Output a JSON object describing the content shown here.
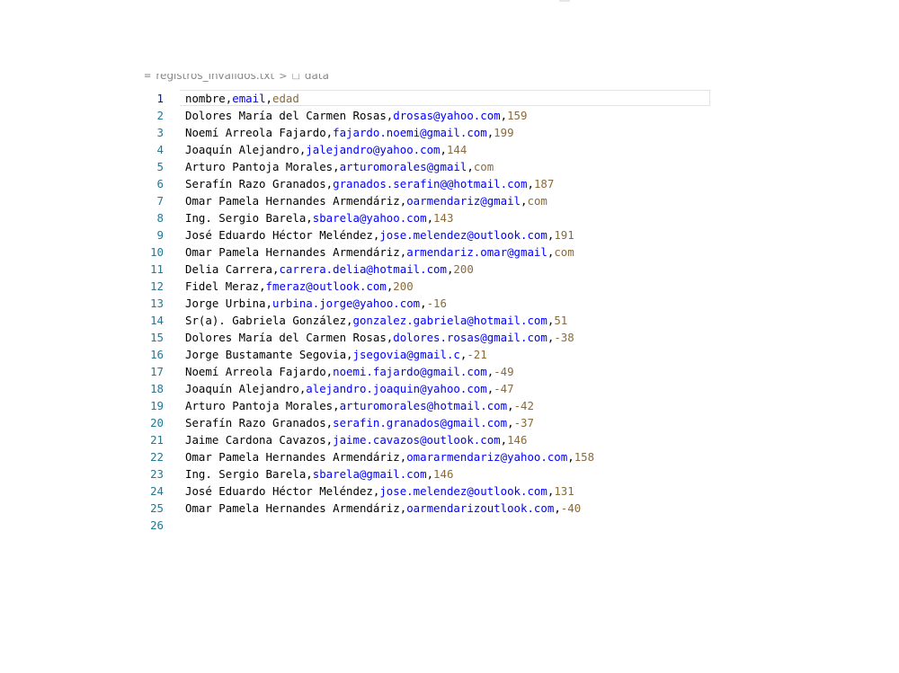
{
  "breadcrumb": {
    "file": "registros_invalidos.txt",
    "separator": ">",
    "section": "data"
  },
  "colors": {
    "text": "#000000",
    "email": "#0000ff",
    "age": "#8a6a3a",
    "line_number": "#237893",
    "active_line_number": "#0b216f"
  },
  "editor": {
    "lines": [
      {
        "number": "1",
        "name": "nombre",
        "email": "email",
        "age": "edad"
      },
      {
        "number": "2",
        "name": "Dolores María del Carmen Rosas",
        "email": "drosas@yahoo.com",
        "age": "159"
      },
      {
        "number": "3",
        "name": "Noemí Arreola Fajardo",
        "email": "fajardo.noemi@gmail.com",
        "age": "199"
      },
      {
        "number": "4",
        "name": "Joaquín Alejandro",
        "email": "jalejandro@yahoo.com",
        "age": "144"
      },
      {
        "number": "5",
        "name": "Arturo Pantoja Morales",
        "email": "arturomorales@gmail",
        "age": "com"
      },
      {
        "number": "6",
        "name": "Serafín Razo Granados",
        "email": "granados.serafin@@hotmail.com",
        "age": "187"
      },
      {
        "number": "7",
        "name": "Omar Pamela Hernandes Armendáriz",
        "email": "oarmendariz@gmail",
        "age": "com"
      },
      {
        "number": "8",
        "name": "Ing. Sergio Barela",
        "email": "sbarela@yahoo.com",
        "age": "143"
      },
      {
        "number": "9",
        "name": "José Eduardo Héctor Meléndez",
        "email": "jose.melendez@outlook.com",
        "age": "191"
      },
      {
        "number": "10",
        "name": "Omar Pamela Hernandes Armendáriz",
        "email": "armendariz.omar@gmail",
        "age": "com"
      },
      {
        "number": "11",
        "name": "Delia Carrera",
        "email": "carrera.delia@hotmail.com",
        "age": "200"
      },
      {
        "number": "12",
        "name": "Fidel Meraz",
        "email": "fmeraz@outlook.com",
        "age": "200"
      },
      {
        "number": "13",
        "name": "Jorge Urbina",
        "email": "urbina.jorge@yahoo.com",
        "age": "-16"
      },
      {
        "number": "14",
        "name": "Sr(a). Gabriela González",
        "email": "gonzalez.gabriela@hotmail.com",
        "age": "51"
      },
      {
        "number": "15",
        "name": "Dolores María del Carmen Rosas",
        "email": "dolores.rosas@gmail.com",
        "age": "-38"
      },
      {
        "number": "16",
        "name": "Jorge Bustamante Segovia",
        "email": "jsegovia@gmail.c",
        "age": "-21"
      },
      {
        "number": "17",
        "name": "Noemí Arreola Fajardo",
        "email": "noemi.fajardo@gmail.com",
        "age": "-49"
      },
      {
        "number": "18",
        "name": "Joaquín Alejandro",
        "email": "alejandro.joaquin@yahoo.com",
        "age": "-47"
      },
      {
        "number": "19",
        "name": "Arturo Pantoja Morales",
        "email": "arturomorales@hotmail.com",
        "age": "-42"
      },
      {
        "number": "20",
        "name": "Serafín Razo Granados",
        "email": "serafin.granados@gmail.com",
        "age": "-37"
      },
      {
        "number": "21",
        "name": "Jaime Cardona Cavazos",
        "email": "jaime.cavazos@outlook.com",
        "age": "146"
      },
      {
        "number": "22",
        "name": "Omar Pamela Hernandes Armendáriz",
        "email": "omararmendariz@yahoo.com",
        "age": "158"
      },
      {
        "number": "23",
        "name": "Ing. Sergio Barela",
        "email": "sbarela@gmail.com",
        "age": "146"
      },
      {
        "number": "24",
        "name": "José Eduardo Héctor Meléndez",
        "email": "jose.melendez@outlook.com",
        "age": "131"
      },
      {
        "number": "25",
        "name": "Omar Pamela Hernandes Armendáriz",
        "email": "oarmendarizoutlook.com",
        "age": "-40"
      },
      {
        "number": "26",
        "name": "",
        "email": "",
        "age": ""
      }
    ]
  }
}
